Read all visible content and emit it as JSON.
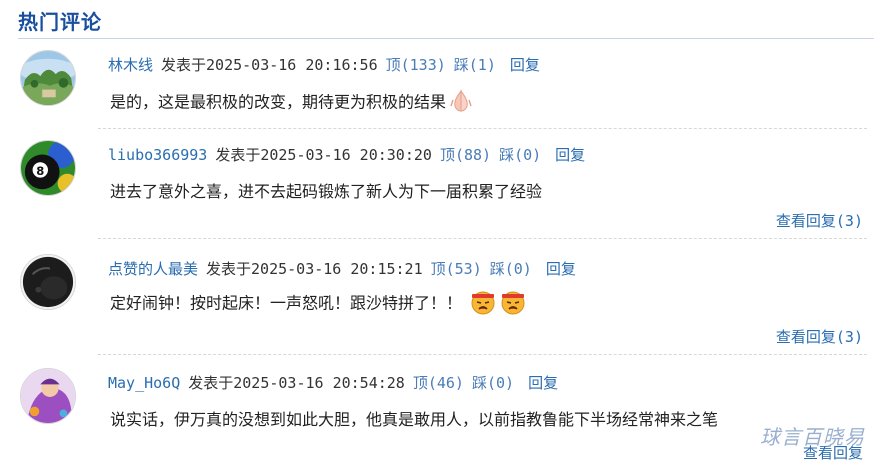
{
  "section": {
    "title": "热门评论"
  },
  "comments": [
    {
      "user": "林木线",
      "posted": "发表于2025-03-16 20:16:56",
      "up": "顶(133)",
      "down": "踩(1)",
      "reply": "回复",
      "text": "是的，这是最积极的改变，期待更为积极的结果",
      "avatar_icon": "landscape-avatar-icon",
      "emoji_icon": "praying-hands-icon"
    },
    {
      "user": "liubo366993",
      "posted": "发表于2025-03-16 20:30:20",
      "up": "顶(88)",
      "down": "踩(0)",
      "reply": "回复",
      "text": "进去了意外之喜，进不去起码锻炼了新人为下一届积累了经验",
      "view_replies": "查看回复(3)",
      "avatar_icon": "billiard-ball-avatar-icon"
    },
    {
      "user": "点赞的人最美",
      "posted": "发表于2025-03-16 20:15:21",
      "up": "顶(53)",
      "down": "踩(0)",
      "reply": "回复",
      "text": "定好闹钟！按时起床！一声怒吼！跟沙特拼了！！",
      "view_replies": "查看回复(3)",
      "avatar_icon": "dark-object-avatar-icon",
      "emoji_icon": "determined-face-icon"
    },
    {
      "user": "May_Ho6Q",
      "posted": "发表于2025-03-16 20:54:28",
      "up": "顶(46)",
      "down": "踩(0)",
      "reply": "回复",
      "text": "说实话，伊万真的没想到如此大胆，他真是敢用人，以前指教鲁能下半场经常神来之笔",
      "view_replies": "查看回复",
      "avatar_icon": "cartoon-figure-avatar-icon"
    }
  ],
  "watermark": "球言百晓易",
  "colors": {
    "title": "#1a4fa0",
    "link": "#2a6db0",
    "rule": "#c9d3e3"
  }
}
